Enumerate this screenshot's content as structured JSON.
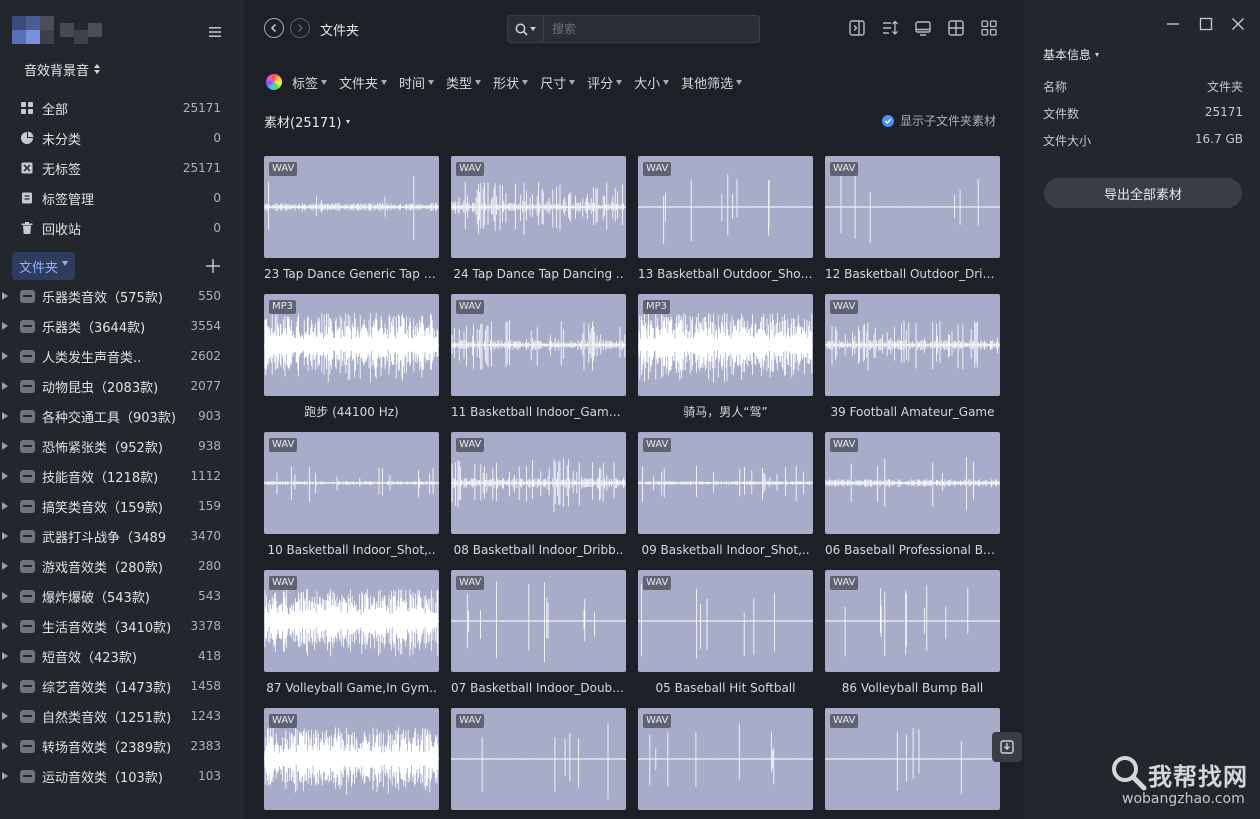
{
  "sidebar": {
    "library_name": "音效背景音",
    "nav": [
      {
        "label": "全部",
        "count": "25171",
        "icon": "grid-icon"
      },
      {
        "label": "未分类",
        "count": "0",
        "icon": "pie-icon"
      },
      {
        "label": "无标签",
        "count": "25171",
        "icon": "no-tag-icon"
      },
      {
        "label": "标签管理",
        "count": "0",
        "icon": "tag-manage-icon"
      },
      {
        "label": "回收站",
        "count": "0",
        "icon": "trash-icon"
      }
    ],
    "folders_label": "文件夹",
    "folders": [
      {
        "label": "乐器类音效（575款)",
        "count": "550"
      },
      {
        "label": "乐器类（3644款)",
        "count": "3554"
      },
      {
        "label": "人类发生声音类..",
        "count": "2602"
      },
      {
        "label": "动物昆虫（2083款)",
        "count": "2077"
      },
      {
        "label": "各种交通工具（903款)",
        "count": "903"
      },
      {
        "label": "恐怖紧张类（952款)",
        "count": "938"
      },
      {
        "label": "技能音效（1218款)",
        "count": "1112"
      },
      {
        "label": "搞笑类音效（159款)",
        "count": "159"
      },
      {
        "label": "武器打斗战争（3489",
        "count": "3470"
      },
      {
        "label": "游戏音效类（280款)",
        "count": "280"
      },
      {
        "label": "爆炸爆破（543款)",
        "count": "543"
      },
      {
        "label": "生活音效类（3410款)",
        "count": "3378"
      },
      {
        "label": "短音效（423款)",
        "count": "418"
      },
      {
        "label": "综艺音效类（1473款)",
        "count": "1458"
      },
      {
        "label": "自然类音效（1251款)",
        "count": "1243"
      },
      {
        "label": "转场音效类（2389款)",
        "count": "2383"
      },
      {
        "label": "运动音效类（103款)",
        "count": "103"
      }
    ]
  },
  "main": {
    "breadcrumb": "文件夹",
    "search_placeholder": "搜索",
    "filters": [
      "标签",
      "文件夹",
      "时间",
      "类型",
      "形状",
      "尺寸",
      "评分",
      "大小",
      "其他筛选"
    ],
    "count_title": "素材(25171)",
    "subfolder_toggle": "显示子文件夹素材",
    "items": [
      {
        "badge": "WAV",
        "caption": "23 Tap Dance Generic Tap D..",
        "wave": "sparse"
      },
      {
        "badge": "WAV",
        "caption": "24 Tap Dance Tap Dancing ..",
        "wave": "medium"
      },
      {
        "badge": "WAV",
        "caption": "13 Basketball Outdoor_Shot,..",
        "wave": "spikes"
      },
      {
        "badge": "WAV",
        "caption": "12 Basketball Outdoor_Dribb..",
        "wave": "spikes2"
      },
      {
        "badge": "MP3",
        "caption": "跑步 (44100 Hz)",
        "wave": "dense"
      },
      {
        "badge": "WAV",
        "caption": "11 Basketball Indoor_Game,..",
        "wave": "medium2"
      },
      {
        "badge": "MP3",
        "caption": "骑马，男人“驾”",
        "wave": "dense2"
      },
      {
        "badge": "WAV",
        "caption": "39 Football Amateur_Game",
        "wave": "medium3"
      },
      {
        "badge": "WAV",
        "caption": "10 Basketball Indoor_Shot,..",
        "wave": "blobs"
      },
      {
        "badge": "WAV",
        "caption": "08 Basketball Indoor_Dribb..",
        "wave": "medium4"
      },
      {
        "badge": "WAV",
        "caption": "09 Basketball Indoor_Shot,..",
        "wave": "blobs2"
      },
      {
        "badge": "WAV",
        "caption": "06 Baseball Professional Bas..",
        "wave": "low"
      },
      {
        "badge": "WAV",
        "caption": "87 Volleyball Game,In Gym..",
        "wave": "dense3"
      },
      {
        "badge": "WAV",
        "caption": "07 Basketball Indoor_Double..",
        "wave": "few"
      },
      {
        "badge": "WAV",
        "caption": "05 Baseball Hit Softball",
        "wave": "lines"
      },
      {
        "badge": "WAV",
        "caption": "86 Volleyball Bump Ball",
        "wave": "few2"
      },
      {
        "badge": "WAV",
        "caption": "",
        "wave": "dense4"
      },
      {
        "badge": "WAV",
        "caption": "",
        "wave": "few3"
      },
      {
        "badge": "WAV",
        "caption": "",
        "wave": "few4"
      },
      {
        "badge": "WAV",
        "caption": "",
        "wave": "lines2"
      }
    ]
  },
  "info": {
    "title": "基本信息",
    "rows": [
      {
        "k": "名称",
        "v": "文件夹"
      },
      {
        "k": "文件数",
        "v": "25171"
      },
      {
        "k": "文件大小",
        "v": "16.7 GB"
      }
    ],
    "export_label": "导出全部素材"
  },
  "watermark": {
    "text": "我帮找网",
    "url": "wobangzhao.com"
  },
  "colors": {
    "thumb_bg": "#a7adc9",
    "wave": "#ffffff",
    "accent": "#4d8dff"
  }
}
